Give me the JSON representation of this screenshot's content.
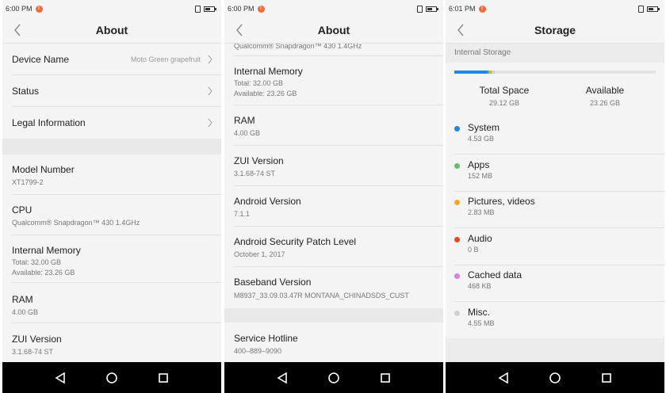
{
  "screens": [
    {
      "status": {
        "time": "6:00 PM"
      },
      "title": "About",
      "rows": [
        {
          "label": "Device Name",
          "value": "Moto Green grapefruit"
        },
        {
          "label": "Status"
        },
        {
          "label": "Legal Information"
        },
        {
          "label": "Model Number",
          "sub": "XT1799-2"
        },
        {
          "label": "CPU",
          "sub": "Qualcomm® Snapdragon™ 430 1.4GHz"
        },
        {
          "label": "Internal Memory",
          "sub": "Total: 32.00 GB",
          "sub2": "Available: 23.26 GB"
        },
        {
          "label": "RAM",
          "sub": "4.00 GB"
        },
        {
          "label": "ZUI Version",
          "sub": "3.1.68-74 ST"
        }
      ]
    },
    {
      "status": {
        "time": "6:00 PM"
      },
      "title": "About",
      "rows": [
        {
          "sub": "Qualcomm® Snapdragon™ 430 1.4GHz"
        },
        {
          "label": "Internal Memory",
          "sub": "Total: 32.00 GB",
          "sub2": "Available: 23.26 GB"
        },
        {
          "label": "RAM",
          "sub": "4.00 GB"
        },
        {
          "label": "ZUI Version",
          "sub": "3.1.68-74 ST"
        },
        {
          "label": "Android Version",
          "sub": "7.1.1"
        },
        {
          "label": "Android Security Patch Level",
          "sub": "October 1, 2017"
        },
        {
          "label": "Baseband Version",
          "sub": "M8937_33.09.03.47R MONTANA_CHINADSDS_CUST"
        },
        {
          "label": "Service Hotline",
          "sub": "400–889–9090"
        }
      ]
    },
    {
      "status": {
        "time": "6:01 PM"
      },
      "title": "Storage",
      "section": "Internal Storage",
      "total_label": "Total Space",
      "total_value": "29.12 GB",
      "available_label": "Available",
      "available_value": "23.26 GB",
      "usage_fraction": 0.2,
      "categories": [
        {
          "label": "System",
          "size": "4.53 GB",
          "color": "#1e88e5"
        },
        {
          "label": "Apps",
          "size": "152 MB",
          "color": "#66bb6a"
        },
        {
          "label": "Pictures, videos",
          "size": "2.83 MB",
          "color": "#f9a825"
        },
        {
          "label": "Audio",
          "size": "0 B",
          "color": "#e64a19"
        },
        {
          "label": "Cached data",
          "size": "468 KB",
          "color": "#d77fe0"
        },
        {
          "label": "Misc.",
          "size": "4.55 MB",
          "color": "#cfcfcf"
        }
      ]
    }
  ],
  "icons": {
    "back": "chevron-left-icon",
    "chevron": "chevron-right-icon",
    "nav_back": "triangle-back-icon",
    "nav_home": "circle-home-icon",
    "nav_recents": "square-recents-icon"
  }
}
